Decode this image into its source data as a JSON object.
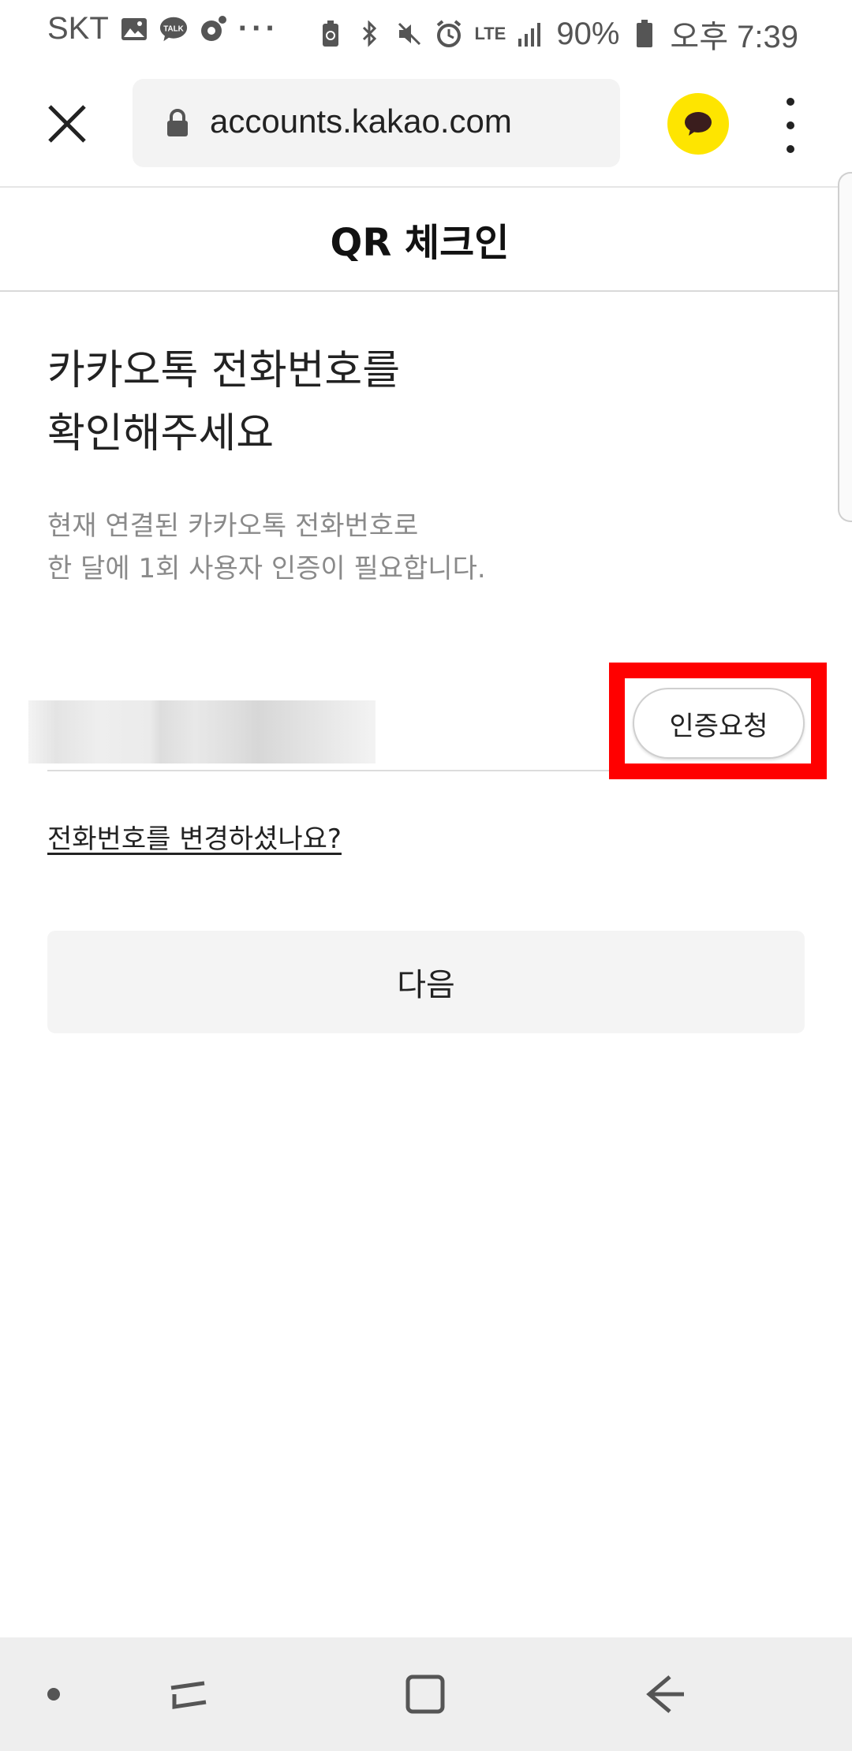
{
  "status_bar": {
    "carrier": "SKT",
    "talk_badge": "TALK",
    "more_indicator": "···",
    "network": "LTE",
    "battery": "90%",
    "time": "오후 7:39",
    "icons": [
      "image-icon",
      "kakaotalk-icon",
      "camera-icon",
      "battery-saver-icon",
      "bluetooth-icon",
      "mute-icon",
      "alarm-icon",
      "signal-icon",
      "battery-icon"
    ]
  },
  "browser": {
    "url": "accounts.kakao.com",
    "icons": [
      "close-icon",
      "lock-icon",
      "kakao-chat-icon",
      "more-vert-icon"
    ]
  },
  "page": {
    "title": "QR 체크인",
    "headline_line1": "카카오톡 전화번호를",
    "headline_line2": "확인해주세요",
    "desc_line1": "현재 연결된 카카오톡 전화번호로",
    "desc_line2": "한 달에 1회 사용자 인증이 필요합니다.",
    "verify_button": "인증요청",
    "change_phone_link": "전화번호를 변경하셨나요?",
    "next_button": "다음"
  },
  "colors": {
    "kakao_yellow": "#fee500",
    "highlight_red": "#ff0000",
    "nav_bg": "#eeeeee"
  },
  "nav_bar": {
    "icons": [
      "dot-icon",
      "recents-icon",
      "home-icon",
      "back-icon"
    ]
  }
}
